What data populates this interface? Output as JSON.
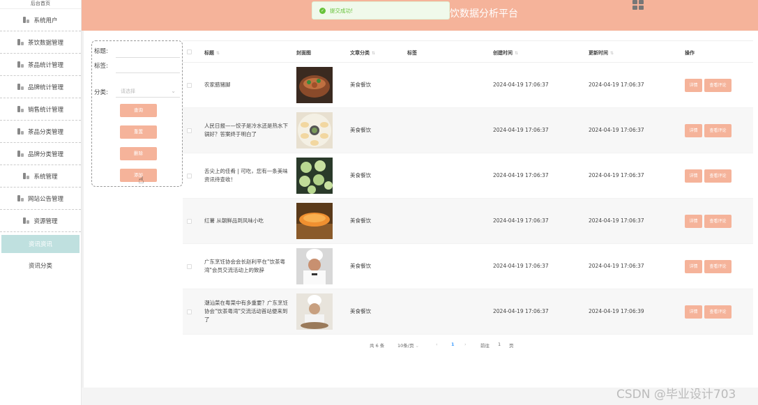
{
  "sidebar": {
    "top": "后台首页",
    "items": [
      {
        "label": "系统用户"
      },
      {
        "label": "茶饮数据管理"
      },
      {
        "label": "茶品统计管理"
      },
      {
        "label": "品牌统计管理"
      },
      {
        "label": "销售统计管理"
      },
      {
        "label": "茶品分类管理"
      },
      {
        "label": "品牌分类管理"
      },
      {
        "label": "系统管理"
      },
      {
        "label": "网站公告管理"
      },
      {
        "label": "资源管理"
      }
    ],
    "sub_active": "资讯资讯",
    "sub_item": "资讯分类"
  },
  "header": {
    "title": "饮数据分析平台"
  },
  "toast": {
    "text": "提交成功!"
  },
  "filter": {
    "title_label": "标题:",
    "tag_label": "标签:",
    "category_label": "分类:",
    "category_placeholder": "请选择",
    "buttons": [
      "查询",
      "重置",
      "删除",
      "添加"
    ]
  },
  "table": {
    "headers": {
      "title": "标题",
      "cover": "封面图",
      "category": "文章分类",
      "tag": "标签",
      "created": "创建时间",
      "updated": "更新时间",
      "actions": "操作"
    },
    "rows": [
      {
        "title": "农家腊猪脚",
        "category": "美食餐饮",
        "created": "2024-04-19 17:06:37",
        "updated": "2024-04-19 17:06:37"
      },
      {
        "title": "人民日报——饺子是冷水还是热水下锅好？答案终于明白了",
        "category": "美食餐饮",
        "created": "2024-04-19 17:06:37",
        "updated": "2024-04-19 17:06:37"
      },
      {
        "title": "舌尖上的佳肴 | 可吃，您有一条美味资讯待查收！",
        "category": "美食餐饮",
        "created": "2024-04-19 17:06:37",
        "updated": "2024-04-19 17:06:37"
      },
      {
        "title": "红薯 从朝鲜品到风味小吃",
        "category": "美食餐饮",
        "created": "2024-04-19 17:06:37",
        "updated": "2024-04-19 17:06:37"
      },
      {
        "title": "广东烹饪协会会长赵利平在\"饮茶粤湾\"会员交流活动上的致辞",
        "category": "美食餐饮",
        "created": "2024-04-19 17:06:37",
        "updated": "2024-04-19 17:06:37"
      },
      {
        "title": "潮汕菜在粤菜中有多重要？广东烹饪协会\"饮茶粤湾\"交流活动首站便来到了",
        "category": "美食餐饮",
        "created": "2024-04-19 17:06:37",
        "updated": "2024-04-19 17:06:39"
      }
    ],
    "detail_label": "详情",
    "comment_label": "查看评论"
  },
  "pager": {
    "total": "共 6 条",
    "page_size": "10条/页",
    "current": "1",
    "goto": "前往",
    "goto_value": "1",
    "page_unit": "页"
  },
  "watermark": "CSDN @毕业设计703"
}
